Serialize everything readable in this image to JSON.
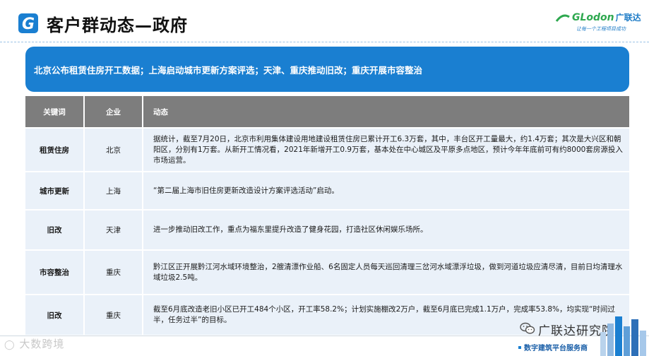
{
  "header": {
    "logo_letter": "G",
    "title": "客户群动态—政府",
    "brand_name": "GLodon",
    "brand_cn": "广联达",
    "brand_tagline": "让每一个工程项目成功"
  },
  "banner": {
    "text": "北京公布租赁住房开工数据；上海启动城市更新方案评选；天津、重庆推动旧改；重庆开展市容整治"
  },
  "table": {
    "headers": [
      "关键词",
      "企业",
      "动态"
    ],
    "rows": [
      {
        "keyword": "租赁住房",
        "company": "北京",
        "detail": "据统计，截至7月20日，北京市利用集体建设用地建设租赁住房已累计开工6.3万套，其中，丰台区开工量最大，约1.4万套；其次是大兴区和朝阳区，分别有1万套。从新开工情况看，2021年新增开工0.9万套，基本处在中心城区及平原多点地区，预计今年年底前可有约8000套房源投入市场运营。"
      },
      {
        "keyword": "城市更新",
        "company": "上海",
        "detail": "“第二届上海市旧住房更新改造设计方案评选活动”启动。"
      },
      {
        "keyword": "旧改",
        "company": "天津",
        "detail": "进一步推动旧改工作，重点为福东里提升改造了健身花园，打造社区休闲娱乐场所。"
      },
      {
        "keyword": "市容整治",
        "company": "重庆",
        "detail": "黔江区正开展黔江河水域环境整治，2艘清漂作业船、6名固定人员每天巡回清理三岔河水域漂浮垃圾，做到河道垃圾应清尽清，目前日均清理水域垃圾2.5吨。"
      },
      {
        "keyword": "旧改",
        "company": "重庆",
        "detail": "截至6月底改造老旧小区已开工484个小区，开工率58.2%；计划实施棚改2万户，截至6月底已完成1.1万户，完成率53.8%，均实现“时间过半，任务过半”的目标。"
      }
    ]
  },
  "footer": {
    "wechat_name": "广联达研究院",
    "slogan": "数字建筑平台服务商",
    "watermark": "大数跨境"
  },
  "colors": {
    "accent": "#1a7fd1",
    "header_row": "#7d7d7d",
    "row_bg": "#eaf1f9",
    "brand_green": "#2ea84f"
  },
  "icons": [
    "g-logo-icon",
    "wechat-icon",
    "city-skyline-icon"
  ]
}
